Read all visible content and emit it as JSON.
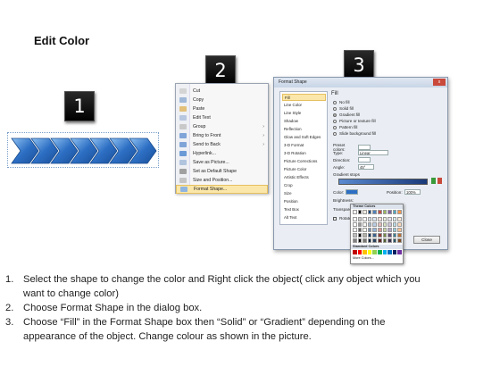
{
  "title": "Edit Color",
  "badges": [
    "1",
    "2",
    "3"
  ],
  "colors": {
    "arrow_fill": "#2d6fc4",
    "arrow_light": "#7db3ea",
    "badge_bg": "#000000",
    "menu_highlight": "#fbe7a9"
  },
  "context_menu": {
    "items": [
      {
        "label": "Cut",
        "icon": "scissors-icon"
      },
      {
        "label": "Copy",
        "icon": "copy-icon"
      },
      {
        "label": "Paste",
        "icon": "paste-icon"
      },
      {
        "label": "Edit Text",
        "icon": "edit-text-icon"
      },
      {
        "label": "Group",
        "icon": "group-icon",
        "submenu": true
      },
      {
        "label": "Bring to Front",
        "icon": "bring-front-icon",
        "submenu": true
      },
      {
        "label": "Send to Back",
        "icon": "send-back-icon",
        "submenu": true
      },
      {
        "label": "Hyperlink...",
        "icon": "hyperlink-icon"
      },
      {
        "label": "Save as Picture...",
        "icon": "save-picture-icon"
      },
      {
        "label": "Set as Default Shape",
        "icon": "default-shape-icon"
      },
      {
        "label": "Size and Position...",
        "icon": "size-icon"
      },
      {
        "label": "Format Shape...",
        "icon": "format-shape-icon",
        "highlighted": true
      }
    ]
  },
  "dialog": {
    "title": "Format Shape",
    "close_x": "x",
    "nav": [
      "Fill",
      "Line Color",
      "Line Style",
      "Shadow",
      "Reflection",
      "Glow and Soft Edges",
      "3-D Format",
      "3-D Rotation",
      "Picture Corrections",
      "Picture Color",
      "Artistic Effects",
      "Crop",
      "Size",
      "Position",
      "Text Box",
      "Alt Text"
    ],
    "heading": "Fill",
    "fill_options": [
      "No fill",
      "Solid fill",
      "Gradient fill",
      "Picture or texture fill",
      "Pattern fill",
      "Slide background fill"
    ],
    "selected_fill": "Gradient fill",
    "fields": {
      "preset_label": "Preset colors:",
      "type_label": "Type:",
      "type_value": "Linear",
      "direction_label": "Direction:",
      "angle_label": "Angle:",
      "angle_value": "45°",
      "stops_label": "Gradient stops",
      "color_label": "Color:",
      "position_label": "Position:",
      "position_value": "100%",
      "brightness_label": "Brightness:",
      "transparency_label": "Transparency:",
      "rotate_label": "Rotate with shape"
    },
    "close_button": "Close"
  },
  "palette": {
    "theme_label": "Theme Colors",
    "standard_label": "Standard Colors",
    "more_label": "More Colors...",
    "theme_top": [
      "#ffffff",
      "#000000",
      "#eeece1",
      "#1f497d",
      "#4f81bd",
      "#c0504d",
      "#9bbb59",
      "#8064a2",
      "#4bacc6",
      "#f79646"
    ],
    "standard": [
      "#c00000",
      "#ff0000",
      "#ffc000",
      "#ffff00",
      "#92d050",
      "#00b050",
      "#00b0f0",
      "#0070c0",
      "#002060",
      "#7030a0"
    ]
  },
  "instructions": [
    {
      "n": "1.",
      "text": "Select the shape to change the color and Right click the object( click any object which you"
    },
    {
      "n": "",
      "text": "want to change color)"
    },
    {
      "n": "2.",
      "text": "Choose Format Shape in the dialog box."
    },
    {
      "n": "3.",
      "text": "Choose “Fill” in the Format Shape box then “Solid” or “Gradient” depending on the"
    },
    {
      "n": "",
      "text": "appearance of the object. Change colour as shown in the picture."
    }
  ]
}
